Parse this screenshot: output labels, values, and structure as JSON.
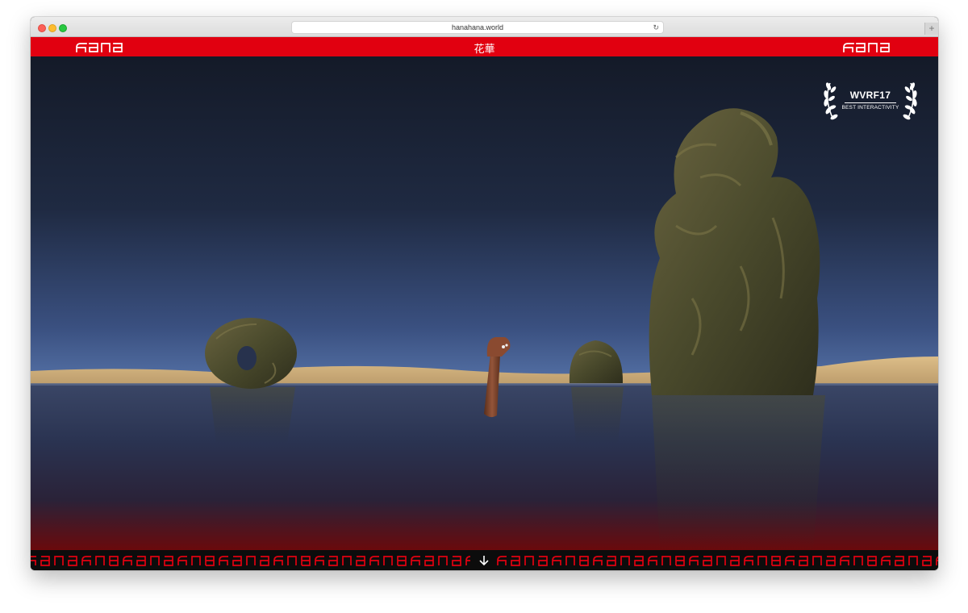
{
  "browser": {
    "url": "hanahana.world",
    "reload_icon": "reload-icon",
    "newtab_label": "+"
  },
  "header": {
    "logo_left": "hana",
    "title": "花華",
    "logo_right": "hana",
    "background": "#e10010"
  },
  "award": {
    "title": "WVRF17",
    "subtitle": "BEST INTERACTIVITY"
  },
  "footer": {
    "scroll_icon": "down-arrow-icon",
    "pattern_color": "#e10010"
  },
  "colors": {
    "accent": "#e10010",
    "sky_top": "#161c2b",
    "sky_horizon": "#4d6aa1",
    "sand": "#d4b17f",
    "water": "#2c3756"
  }
}
